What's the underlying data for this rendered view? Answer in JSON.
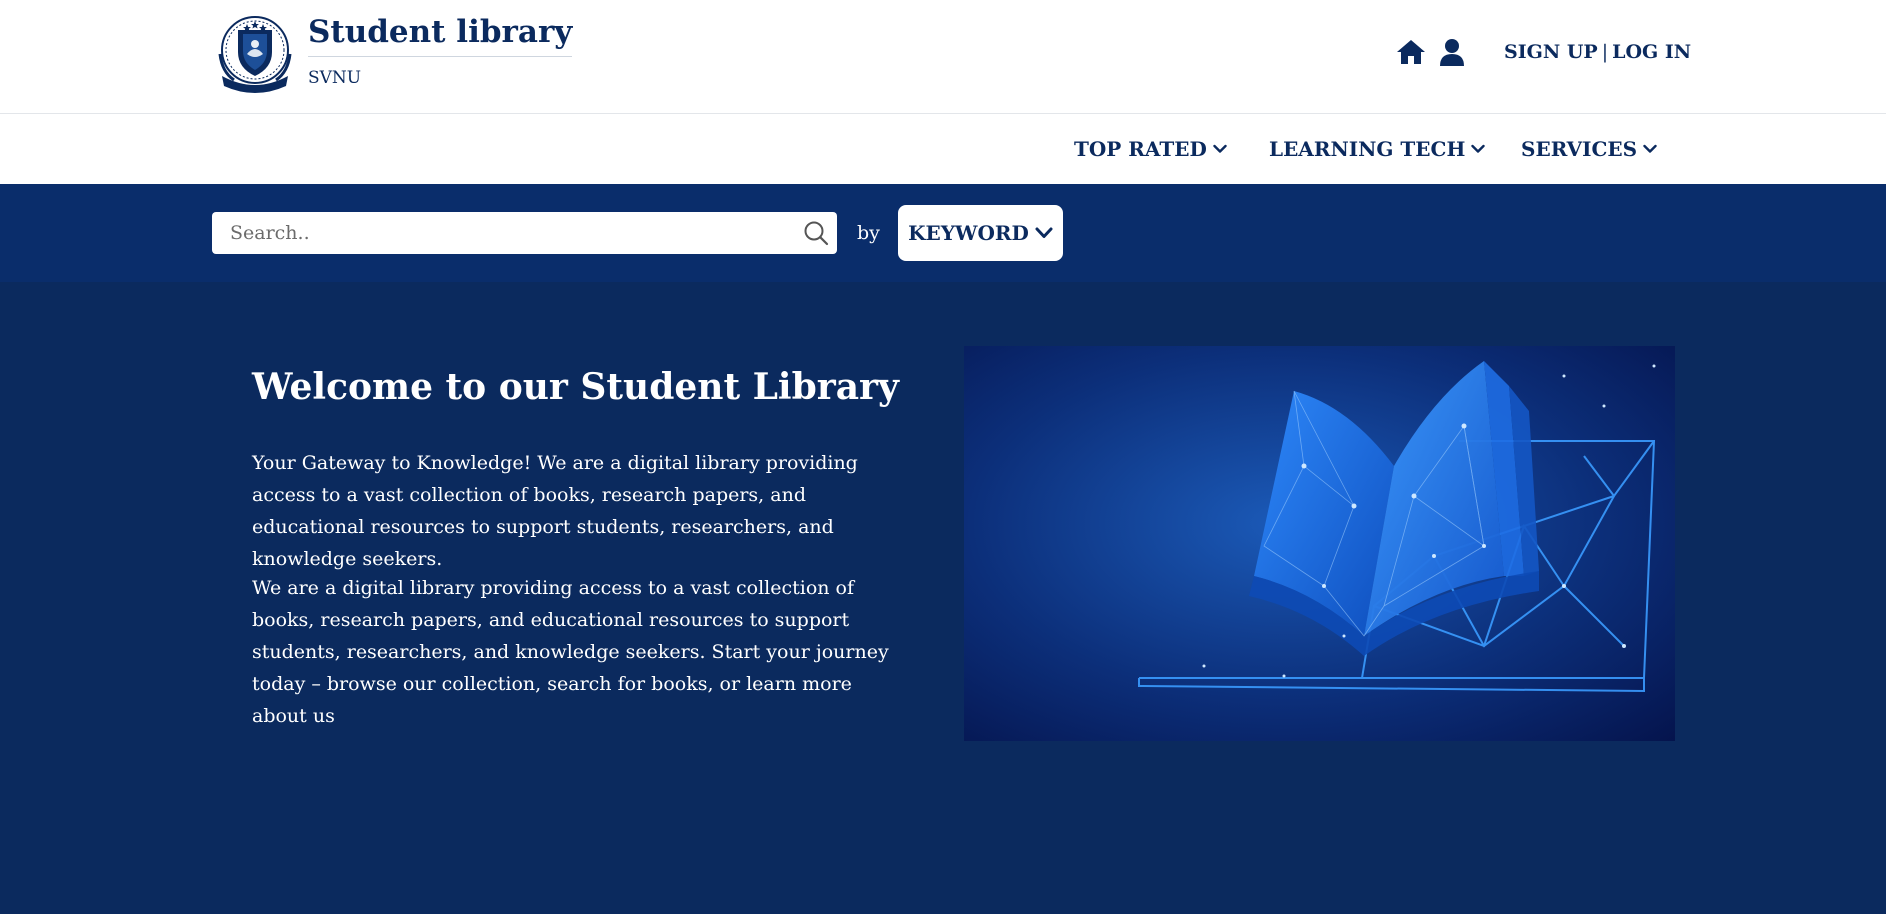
{
  "header": {
    "brand_title": "Student library",
    "brand_subtitle": "SVNU",
    "sign_up": "SIGN UP",
    "separator": "|",
    "log_in": "LOG IN"
  },
  "nav": {
    "items": [
      {
        "label": "TOP RATED"
      },
      {
        "label": "LEARNING TECH"
      },
      {
        "label": "SERVICES"
      }
    ]
  },
  "search": {
    "placeholder": "Search..",
    "value": "",
    "by_label": "by",
    "filter_selected": "KEYWORD"
  },
  "hero": {
    "title": "Welcome to our Student Library",
    "paragraph1": "Your Gateway to Knowledge! We are a digital library providing access to a vast collection of books, research papers, and educational resources to support students, researchers, and knowledge seekers.",
    "paragraph2": "We are a digital library providing access to a vast collection of books, research papers, and educational resources to support students, researchers, and knowledge seekers. Start your journey today – browse our collection, search for books, or learn more about us"
  },
  "icons": {
    "logo": "university-crest-logo",
    "home": "home-icon",
    "user": "user-icon",
    "search": "search-icon",
    "chevron": "chevron-down-icon",
    "hero_image": "glowing-book-laptop-illustration"
  },
  "colors": {
    "primary": "#0b2a5e",
    "search_band": "#0a2d6b",
    "surface": "#ffffff",
    "accent_glow": "#2f8cff"
  }
}
